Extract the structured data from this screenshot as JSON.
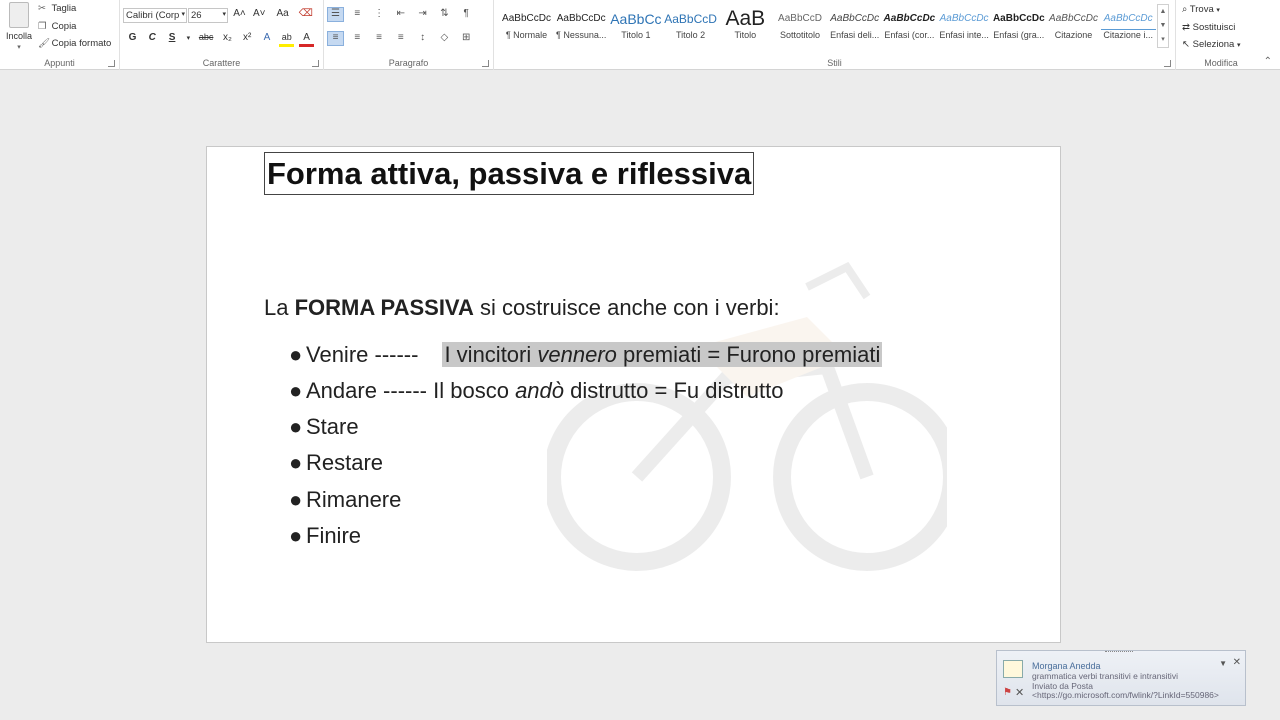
{
  "ribbon": {
    "clipboard": {
      "label": "Appunti",
      "paste": "Incolla",
      "cut": "Taglia",
      "copy": "Copia",
      "format_painter": "Copia formato"
    },
    "font": {
      "label": "Carattere",
      "font_name": "Calibri (Corp",
      "font_size": "26",
      "bold": "G",
      "italic": "C",
      "underline": "S",
      "strikethrough": "abc",
      "subscript": "x₂",
      "superscript": "x²",
      "grow": "A˄",
      "shrink": "A˅",
      "change_case": "Aa",
      "text_effects": "A",
      "highlight": "ab",
      "font_color": "A"
    },
    "paragraph": {
      "label": "Paragrafo"
    },
    "styles": {
      "label": "Stili",
      "items": [
        {
          "sample": "AaBbCcDc",
          "name": "¶ Normale"
        },
        {
          "sample": "AaBbCcDc",
          "name": "¶ Nessuna..."
        },
        {
          "sample": "AaBbCc",
          "name": "Titolo 1"
        },
        {
          "sample": "AaBbCcD",
          "name": "Titolo 2"
        },
        {
          "sample": "AaB",
          "name": "Titolo"
        },
        {
          "sample": "AaBbCcD",
          "name": "Sottotitolo"
        },
        {
          "sample": "AaBbCcDc",
          "name": "Enfasi deli..."
        },
        {
          "sample": "AaBbCcDc",
          "name": "Enfasi (cor..."
        },
        {
          "sample": "AaBbCcDc",
          "name": "Enfasi inte..."
        },
        {
          "sample": "AaBbCcDc",
          "name": "Enfasi (gra..."
        },
        {
          "sample": "AaBbCcDc",
          "name": "Citazione"
        },
        {
          "sample": "AaBbCcDc",
          "name": "Citazione i..."
        }
      ]
    },
    "editing": {
      "label": "Modifica",
      "find": "Trova",
      "replace": "Sostituisci",
      "select": "Seleziona"
    }
  },
  "document": {
    "title": "Forma attiva, passiva e riflessiva",
    "intro_pre": "La ",
    "intro_bold": "FORMA PASSIVA",
    "intro_post": " si costruisce anche con i verbi:",
    "bullet_glyph": "●",
    "bullets": [
      {
        "verb": "Venire ------",
        "ex_pre": "I vincitori ",
        "ex_it": "vennero",
        "ex_post": " premiati = Furono premiati"
      },
      {
        "verb": "Andare ------ ",
        "ex_pre": "Il bosco ",
        "ex_it": "andò",
        "ex_post": " distrutto = Fu distrutto"
      },
      {
        "verb": "Stare"
      },
      {
        "verb": "Restare"
      },
      {
        "verb": "Rimanere"
      },
      {
        "verb": "Finire"
      }
    ]
  },
  "notification": {
    "sender": "Morgana Anedda",
    "subject": "grammatica verbi transitivi e intransitivi",
    "sent_via": "Inviato da Posta",
    "link": "<https://go.microsoft.com/fwlink/?LinkId=550986>"
  }
}
